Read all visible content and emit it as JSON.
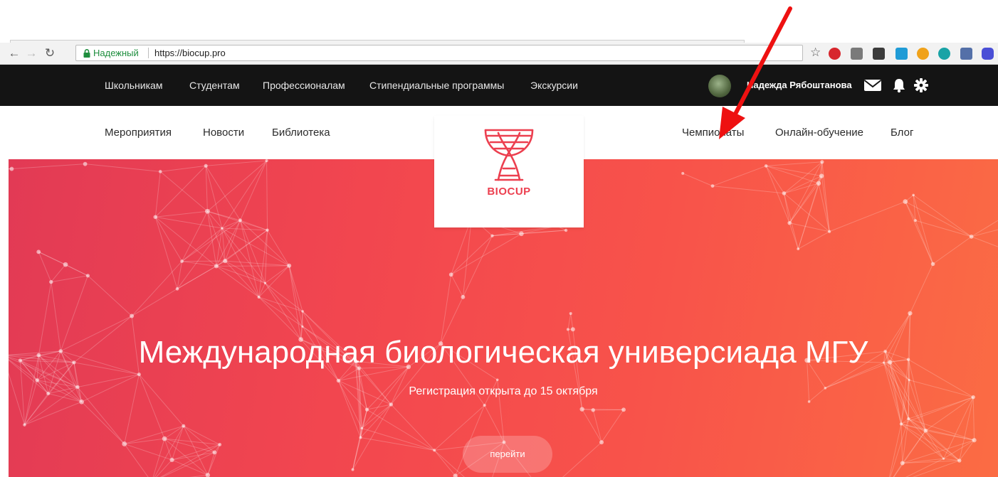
{
  "browser": {
    "secure_label": "Надежный",
    "url": "https://biocup.pro",
    "extensions": [
      "pinterest-icon",
      "extension-gray-icon",
      "extension-dark-icon",
      "extension-x-icon",
      "extension-flower-icon",
      "extension-triangle-icon",
      "extension-book-icon",
      "extension-hex-icon"
    ]
  },
  "topbar": {
    "items": [
      {
        "label": "Школьникам"
      },
      {
        "label": "Студентам"
      },
      {
        "label": "Профессионалам"
      },
      {
        "label": "Стипендиальные программы"
      },
      {
        "label": "Экскурсии"
      }
    ],
    "user_name": "Надежда Рябоштанова"
  },
  "subnav": {
    "left": [
      {
        "label": "Мероприятия"
      },
      {
        "label": "Новости"
      },
      {
        "label": "Библиотека"
      }
    ],
    "right": [
      {
        "label": "Чемпионаты"
      },
      {
        "label": "Онлайн-обучение"
      },
      {
        "label": "Блог"
      }
    ]
  },
  "logo": {
    "text": "BIOCUP"
  },
  "hero": {
    "title": "Международная биологическая универсиада МГУ",
    "subtitle": "Регистрация открыта до 15 октября",
    "button": "перейти"
  },
  "colors": {
    "hero_start": "#e23a55",
    "hero_end": "#fb6c44",
    "brand": "#ec3f4f",
    "annotation_arrow": "#ee1111"
  }
}
